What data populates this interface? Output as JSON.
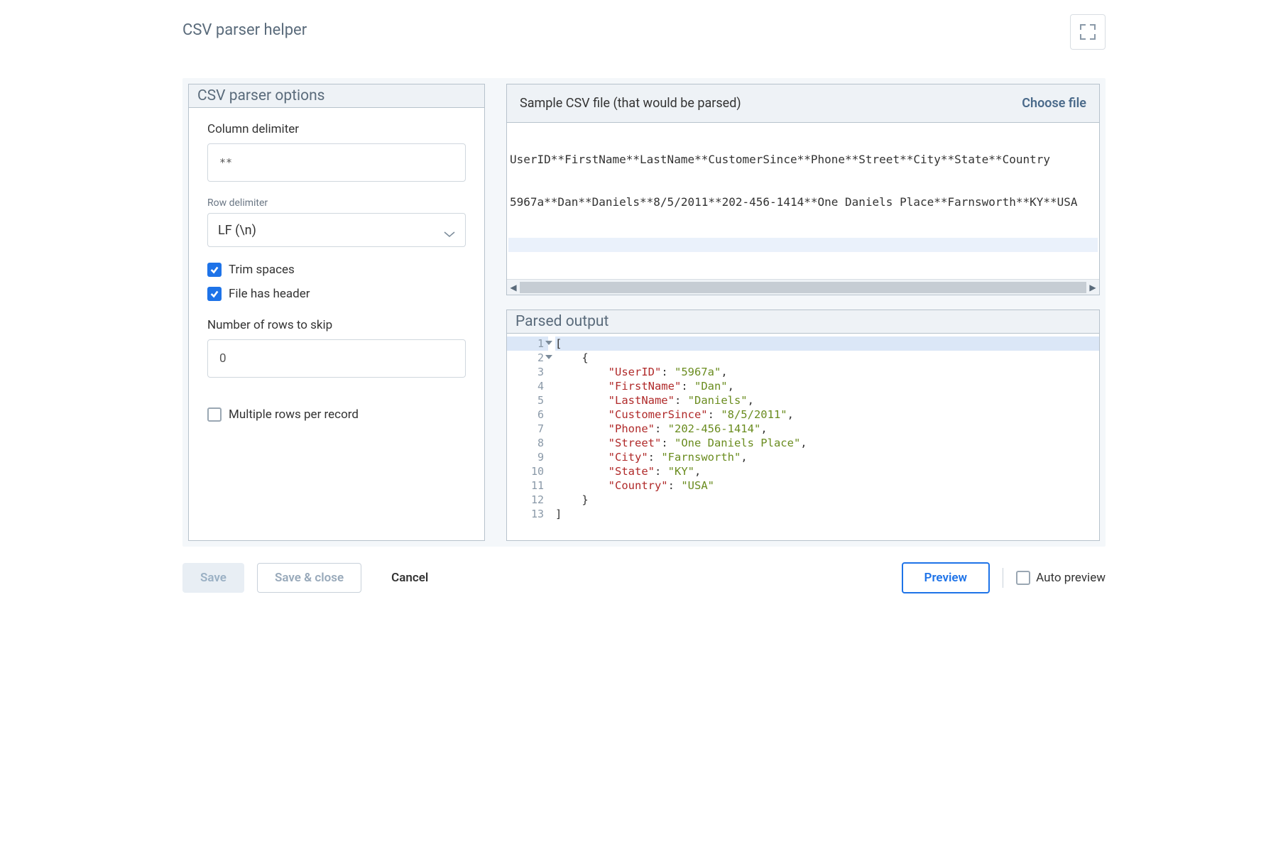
{
  "header": {
    "title": "CSV parser helper"
  },
  "options": {
    "panel_title": "CSV parser options",
    "column_delimiter_label": "Column delimiter",
    "column_delimiter_value": "**",
    "row_delimiter_label": "Row delimiter",
    "row_delimiter_value": "LF (\\n)",
    "trim_spaces_label": "Trim spaces",
    "trim_spaces_checked": true,
    "file_has_header_label": "File has header",
    "file_has_header_checked": true,
    "rows_skip_label": "Number of rows to skip",
    "rows_skip_value": "0",
    "multiple_rows_label": "Multiple rows per record",
    "multiple_rows_checked": false
  },
  "sample": {
    "title": "Sample CSV file (that would be parsed)",
    "choose_file_label": "Choose file",
    "lines": [
      "UserID**FirstName**LastName**CustomerSince**Phone**Street**City**State**Country",
      "5967a**Dan**Daniels**8/5/2011**202-456-1414**One Daniels Place**Farnsworth**KY**USA"
    ]
  },
  "parsed": {
    "title": "Parsed output",
    "record": {
      "UserID": "5967a",
      "FirstName": "Dan",
      "LastName": "Daniels",
      "CustomerSince": "8/5/2011",
      "Phone": "202-456-1414",
      "Street": "One Daniels Place",
      "City": "Farnsworth",
      "State": "KY",
      "Country": "USA"
    }
  },
  "footer": {
    "save_label": "Save",
    "save_close_label": "Save & close",
    "cancel_label": "Cancel",
    "preview_label": "Preview",
    "auto_preview_label": "Auto preview",
    "auto_preview_checked": false
  }
}
